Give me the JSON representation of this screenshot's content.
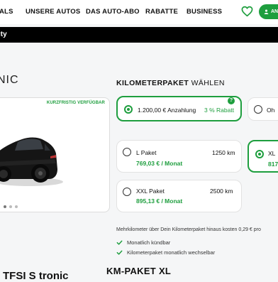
{
  "nav": {
    "items": [
      "ALS",
      "UNSERE AUTOS",
      "DAS AUTO-ABO",
      "RABATTE",
      "BUSINESS"
    ],
    "account_label": "AN"
  },
  "banner": {
    "text": "ity"
  },
  "vehicle": {
    "title_partial": "NIC",
    "badge": "KURZFRISTIG VERFÜGBAR",
    "name_partial": "TFSI S tronic"
  },
  "kilometer": {
    "heading_bold": "KILOMETERPAKET",
    "heading_rest": " WÄHLEN",
    "down_payment": {
      "selected": {
        "label": "1.200,00 € Anzahlung",
        "discount": "3 % Rabatt",
        "help": "?"
      },
      "other": {
        "label": "Oh"
      }
    },
    "packages": [
      {
        "name": "L Paket",
        "km": "1250 km",
        "price": "769,03 € / Monat",
        "selected": false
      },
      {
        "name": "XL",
        "km": "",
        "price": "817",
        "selected": true
      },
      {
        "name": "XXL Paket",
        "km": "2500 km",
        "price": "895,13 € / Monat",
        "selected": false
      }
    ],
    "info": "Mehrkilometer über Dein Kilometerpaket hinaus kosten 0,29 € pro",
    "bullets": [
      "Monatlich kündbar",
      "Kilometerpaket monatlich wechselbar"
    ],
    "selected_title": "KM-PAKET XL"
  },
  "colors": {
    "accent": "#1e9e3e"
  }
}
